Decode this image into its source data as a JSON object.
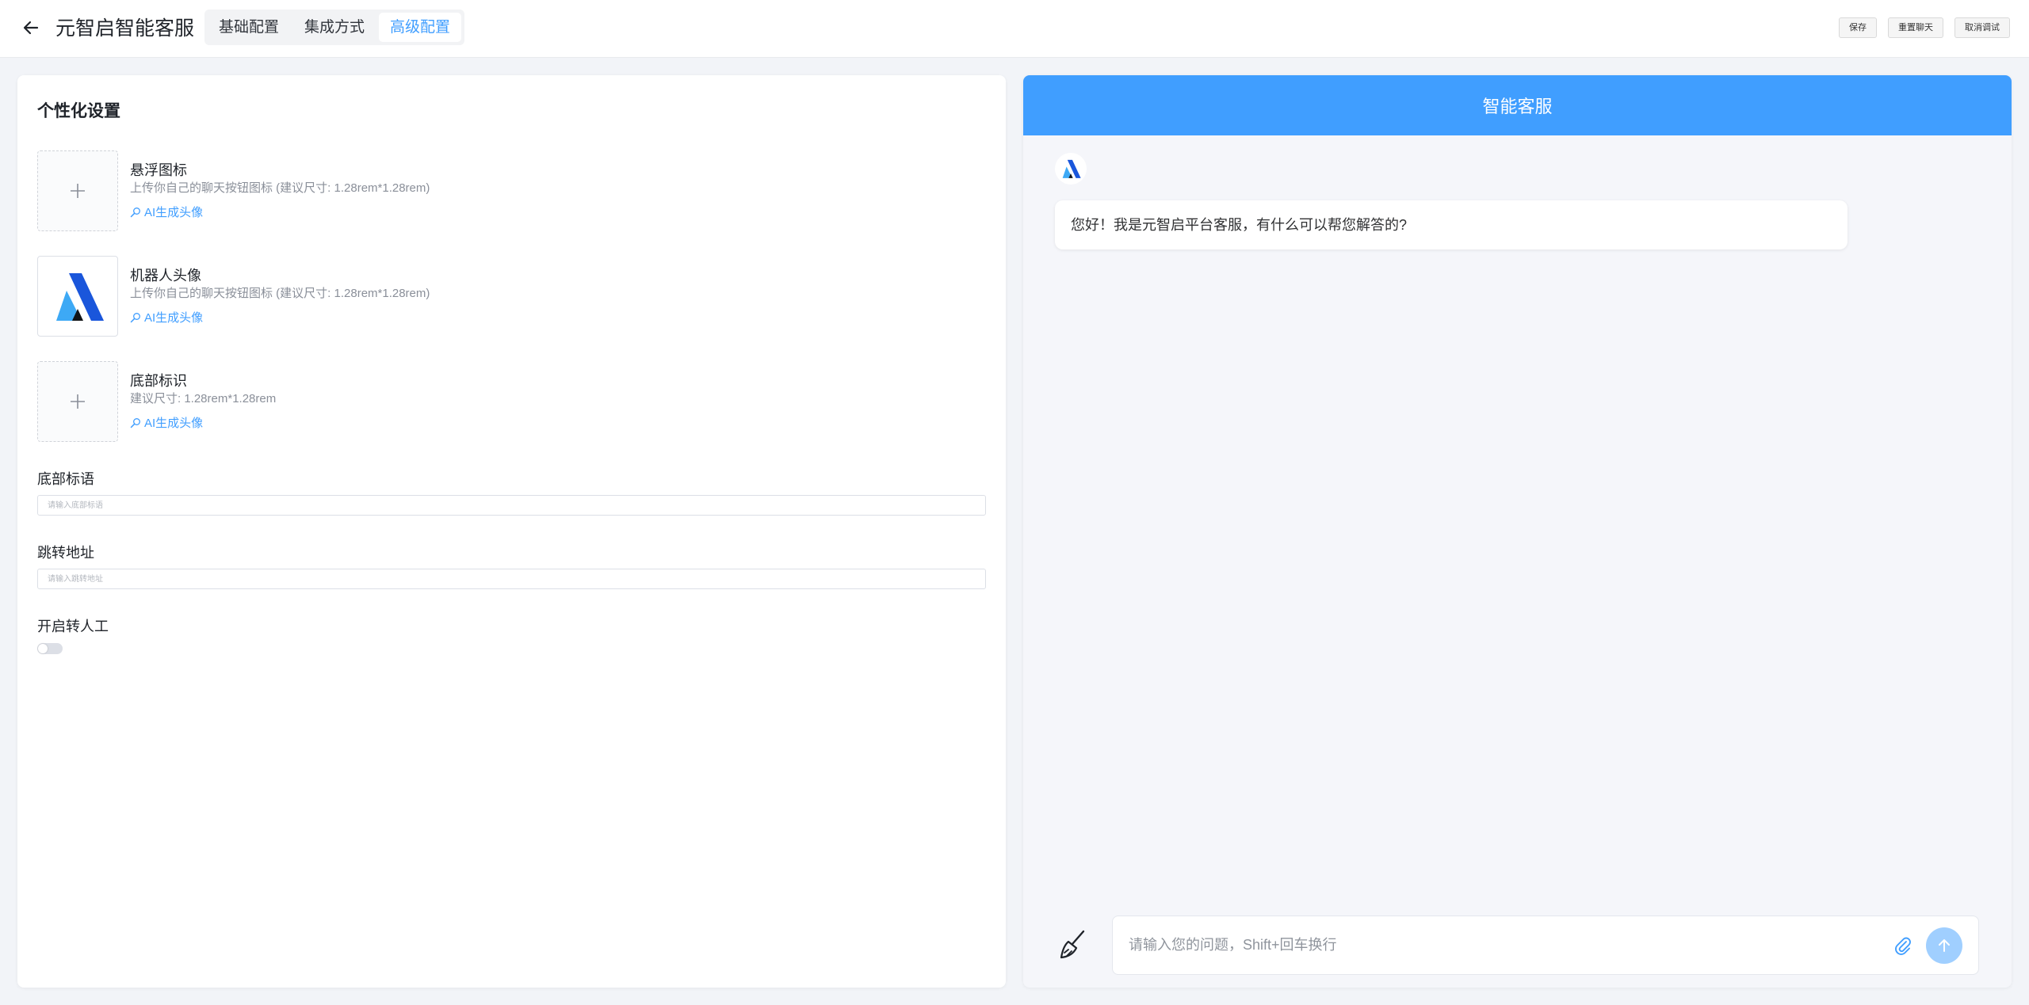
{
  "header": {
    "title": "元智启智能客服",
    "tabs": [
      {
        "label": "基础配置",
        "active": false
      },
      {
        "label": "集成方式",
        "active": false
      },
      {
        "label": "高级配置",
        "active": true
      }
    ],
    "actions": {
      "save": "保存",
      "reset_chat": "重置聊天",
      "cancel_debug": "取消调试"
    }
  },
  "settings": {
    "title": "个性化设置",
    "uploads": [
      {
        "name": "悬浮图标",
        "hint": "上传你自己的聊天按钮图标 (建议尺寸: 1.28rem*1.28rem)",
        "ai_link": "AI生成头像",
        "filled": false
      },
      {
        "name": "机器人头像",
        "hint": "上传你自己的聊天按钮图标 (建议尺寸: 1.28rem*1.28rem)",
        "ai_link": "AI生成头像",
        "filled": true
      },
      {
        "name": "底部标识",
        "hint": "建议尺寸: 1.28rem*1.28rem",
        "ai_link": "AI生成头像",
        "filled": false
      }
    ],
    "footer_slogan": {
      "label": "底部标语",
      "placeholder": "请输入底部标语",
      "value": ""
    },
    "redirect_url": {
      "label": "跳转地址",
      "placeholder": "请输入跳转地址",
      "value": ""
    },
    "human_handoff": {
      "label": "开启转人工",
      "enabled": false
    }
  },
  "chat": {
    "title": "智能客服",
    "messages": [
      {
        "from": "bot",
        "text": "您好！我是元智启平台客服，有什么可以帮您解答的?"
      }
    ],
    "input": {
      "placeholder": "请输入您的问题，Shift+回车换行",
      "value": ""
    }
  },
  "colors": {
    "accent": "#409eff",
    "send_disabled": "#a0cfff",
    "logo_dark": "#1a56db",
    "logo_light": "#3da9f5"
  },
  "icons": {
    "back": "arrow-left-icon",
    "plus": "plus-icon",
    "ai_link": "magic-search-icon",
    "clear": "broom-icon",
    "attach": "paperclip-icon",
    "send": "arrow-up-icon"
  }
}
